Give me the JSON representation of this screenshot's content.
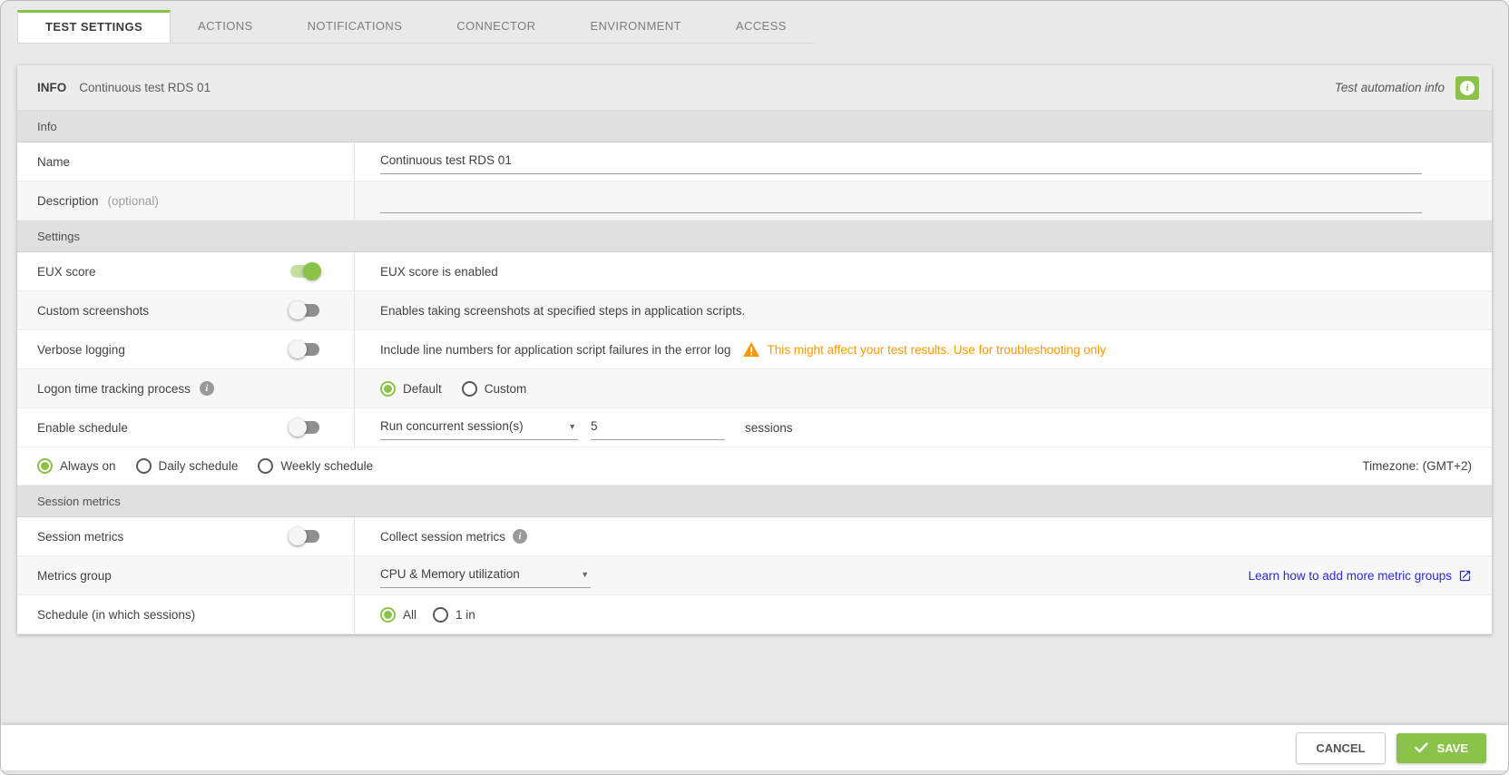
{
  "tabs": [
    {
      "label": "TEST SETTINGS",
      "active": true
    },
    {
      "label": "ACTIONS",
      "active": false
    },
    {
      "label": "NOTIFICATIONS",
      "active": false
    },
    {
      "label": "CONNECTOR",
      "active": false
    },
    {
      "label": "ENVIRONMENT",
      "active": false
    },
    {
      "label": "ACCESS",
      "active": false
    }
  ],
  "info_bar": {
    "tag": "INFO",
    "title": "Continuous test RDS 01",
    "automation_info_label": "Test automation info",
    "info_icon": "info-icon"
  },
  "info_section": {
    "header": "Info",
    "name_label": "Name",
    "name_value": "Continuous test RDS 01",
    "description_label": "Description",
    "description_optional": "(optional)",
    "description_value": ""
  },
  "settings_section": {
    "header": "Settings",
    "eux_score": {
      "label": "EUX score",
      "enabled": true,
      "description": "EUX score is enabled"
    },
    "custom_screenshots": {
      "label": "Custom screenshots",
      "enabled": false,
      "description": "Enables taking screenshots at specified steps in application scripts."
    },
    "verbose_logging": {
      "label": "Verbose logging",
      "enabled": false,
      "description": "Include line numbers for application script failures in the error log",
      "warning": "This might affect your test results. Use for troubleshooting only"
    },
    "logon_tracking": {
      "label": "Logon time tracking process",
      "options": [
        "Default",
        "Custom"
      ],
      "selected": "Default"
    },
    "enable_schedule": {
      "label": "Enable schedule",
      "enabled": false,
      "mode_value": "Run concurrent session(s)",
      "count_value": "5",
      "count_suffix": "sessions"
    },
    "schedule_type": {
      "options": [
        "Always on",
        "Daily schedule",
        "Weekly schedule"
      ],
      "selected": "Always on",
      "timezone": "Timezone: (GMT+2)"
    }
  },
  "session_metrics_section": {
    "header": "Session metrics",
    "session_metrics": {
      "label": "Session metrics",
      "enabled": false,
      "description": "Collect session metrics"
    },
    "metrics_group": {
      "label": "Metrics group",
      "value": "CPU & Memory utilization",
      "link_label": "Learn how to add more metric groups"
    },
    "schedule_sessions": {
      "label": "Schedule (in which sessions)",
      "options": [
        "All",
        "1 in"
      ],
      "selected": "All"
    }
  },
  "footer": {
    "cancel_label": "CANCEL",
    "save_label": "SAVE"
  },
  "colors": {
    "accent_green": "#8bc34a",
    "warning_orange": "#ff9800",
    "link_blue": "#2b2bd5"
  }
}
